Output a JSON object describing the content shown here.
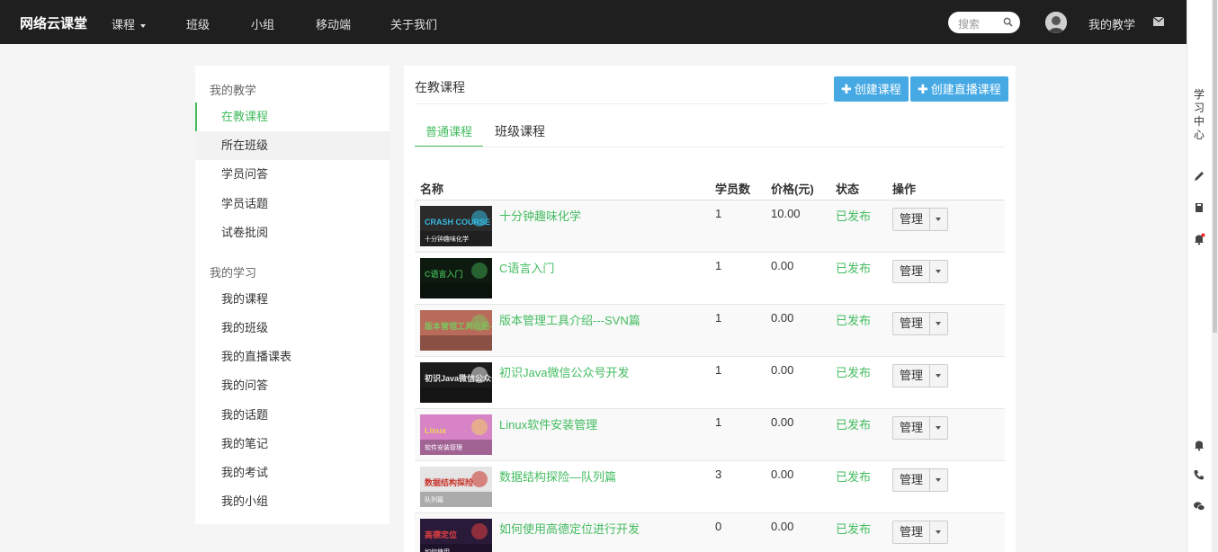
{
  "nav": {
    "brand": "网络云课堂",
    "items": [
      {
        "label": "课程",
        "has_caret": true
      },
      {
        "label": "班级"
      },
      {
        "label": "小组"
      },
      {
        "label": "移动端"
      },
      {
        "label": "关于我们"
      }
    ],
    "search_placeholder": "搜索",
    "user_menu": "我的教学"
  },
  "rail": {
    "label": "学习中心"
  },
  "sidebar": {
    "groups": [
      {
        "title": "我的教学",
        "items": [
          {
            "label": "在教课程",
            "state": "active"
          },
          {
            "label": "所在班级",
            "state": "hover"
          },
          {
            "label": "学员问答"
          },
          {
            "label": "学员话题"
          },
          {
            "label": "试卷批阅"
          }
        ]
      },
      {
        "title": "我的学习",
        "items": [
          {
            "label": "我的课程"
          },
          {
            "label": "我的班级"
          },
          {
            "label": "我的直播课表"
          },
          {
            "label": "我的问答"
          },
          {
            "label": "我的话题"
          },
          {
            "label": "我的笔记"
          },
          {
            "label": "我的考试"
          },
          {
            "label": "我的小组"
          }
        ]
      }
    ]
  },
  "main": {
    "title": "在教课程",
    "buttons": {
      "create_course": "创建课程",
      "create_live": "创建直播课程"
    },
    "tabs": [
      {
        "label": "普通课程",
        "active": true
      },
      {
        "label": "班级课程"
      }
    ],
    "columns": {
      "name": "名称",
      "students": "学员数",
      "price": "价格(元)",
      "status": "状态",
      "action": "操作"
    },
    "courses": [
      {
        "name": "十分钟趣味化学",
        "students": "1",
        "price": "10.00",
        "status": "已发布",
        "action": "管理",
        "thumb": {
          "bg": "#2b2b2b",
          "accent": "#35b8e0",
          "text1": "CRASH COURSE",
          "text2": "十分钟趣味化学"
        }
      },
      {
        "name": "C语言入门",
        "students": "1",
        "price": "0.00",
        "status": "已发布",
        "action": "管理",
        "thumb": {
          "bg": "#0e1a10",
          "accent": "#3aa04a",
          "text1": "C语言入门",
          "text2": ""
        }
      },
      {
        "name": "版本管理工具介绍---SVN篇",
        "students": "1",
        "price": "0.00",
        "status": "已发布",
        "action": "管理",
        "thumb": {
          "bg": "#b86b5a",
          "accent": "#7fc35e",
          "text1": "版本管理工具介绍—SVN篇",
          "text2": ""
        }
      },
      {
        "name": "初识Java微信公众号开发",
        "students": "1",
        "price": "0.00",
        "status": "已发布",
        "action": "管理",
        "thumb": {
          "bg": "#1b1b1b",
          "accent": "#e8e8e8",
          "text1": "初识Java微信公众号开发",
          "text2": ""
        }
      },
      {
        "name": "Linux软件安装管理",
        "students": "1",
        "price": "0.00",
        "status": "已发布",
        "action": "管理",
        "thumb": {
          "bg": "#d783c6",
          "accent": "#f0d060",
          "text1": "Linux",
          "text2": "软件安装管理"
        }
      },
      {
        "name": "数据结构探险—队列篇",
        "students": "3",
        "price": "0.00",
        "status": "已发布",
        "action": "管理",
        "thumb": {
          "bg": "#e5e5e5",
          "accent": "#c8322a",
          "text1": "数据结构探险",
          "text2": "队列篇"
        }
      },
      {
        "name": "如何使用高德定位进行开发",
        "students": "0",
        "price": "0.00",
        "status": "已发布",
        "action": "管理",
        "thumb": {
          "bg": "#2a1a3a",
          "accent": "#e04040",
          "text1": "高德定位",
          "text2": "如何使用"
        }
      }
    ]
  },
  "colors": {
    "accent": "#43bc60",
    "button": "#46a9e4",
    "nav_bg": "#1f1f1f"
  }
}
